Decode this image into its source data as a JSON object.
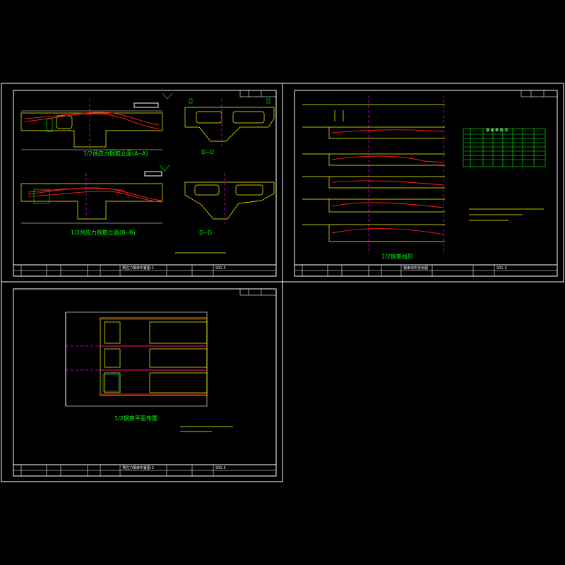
{
  "sheets": [
    {
      "id": "sheet-1",
      "views": [
        {
          "label": "1/2预应力钢筋立面(A--A)"
        },
        {
          "label": "1/2预应力钢筋立面(B--B)"
        },
        {
          "label": "D--D"
        },
        {
          "label": "D--D"
        }
      ],
      "title_block": {
        "drawing_title": "预应力钢束布置图-1",
        "drawing_no": "S01-3"
      }
    },
    {
      "id": "sheet-2",
      "views": [
        {
          "label": "1/2钢束线形"
        },
        {
          "label": "钢 束 参 数 表"
        }
      ],
      "title_block": {
        "drawing_title": "钢束线形坐标图",
        "drawing_no": "S01-3"
      }
    },
    {
      "id": "sheet-3",
      "views": [
        {
          "label": "1/2钢束平面布置"
        }
      ],
      "title_block": {
        "drawing_title": "预应力钢束布置图-2",
        "drawing_no": "S01-3"
      }
    }
  ],
  "colors": {
    "background": "#000000",
    "frame": "#ffffff",
    "outline": "#ffff00",
    "tendon": "#ff2020",
    "centerline": "#ff00ff",
    "label": "#00ff00",
    "table": "#00ff00"
  }
}
